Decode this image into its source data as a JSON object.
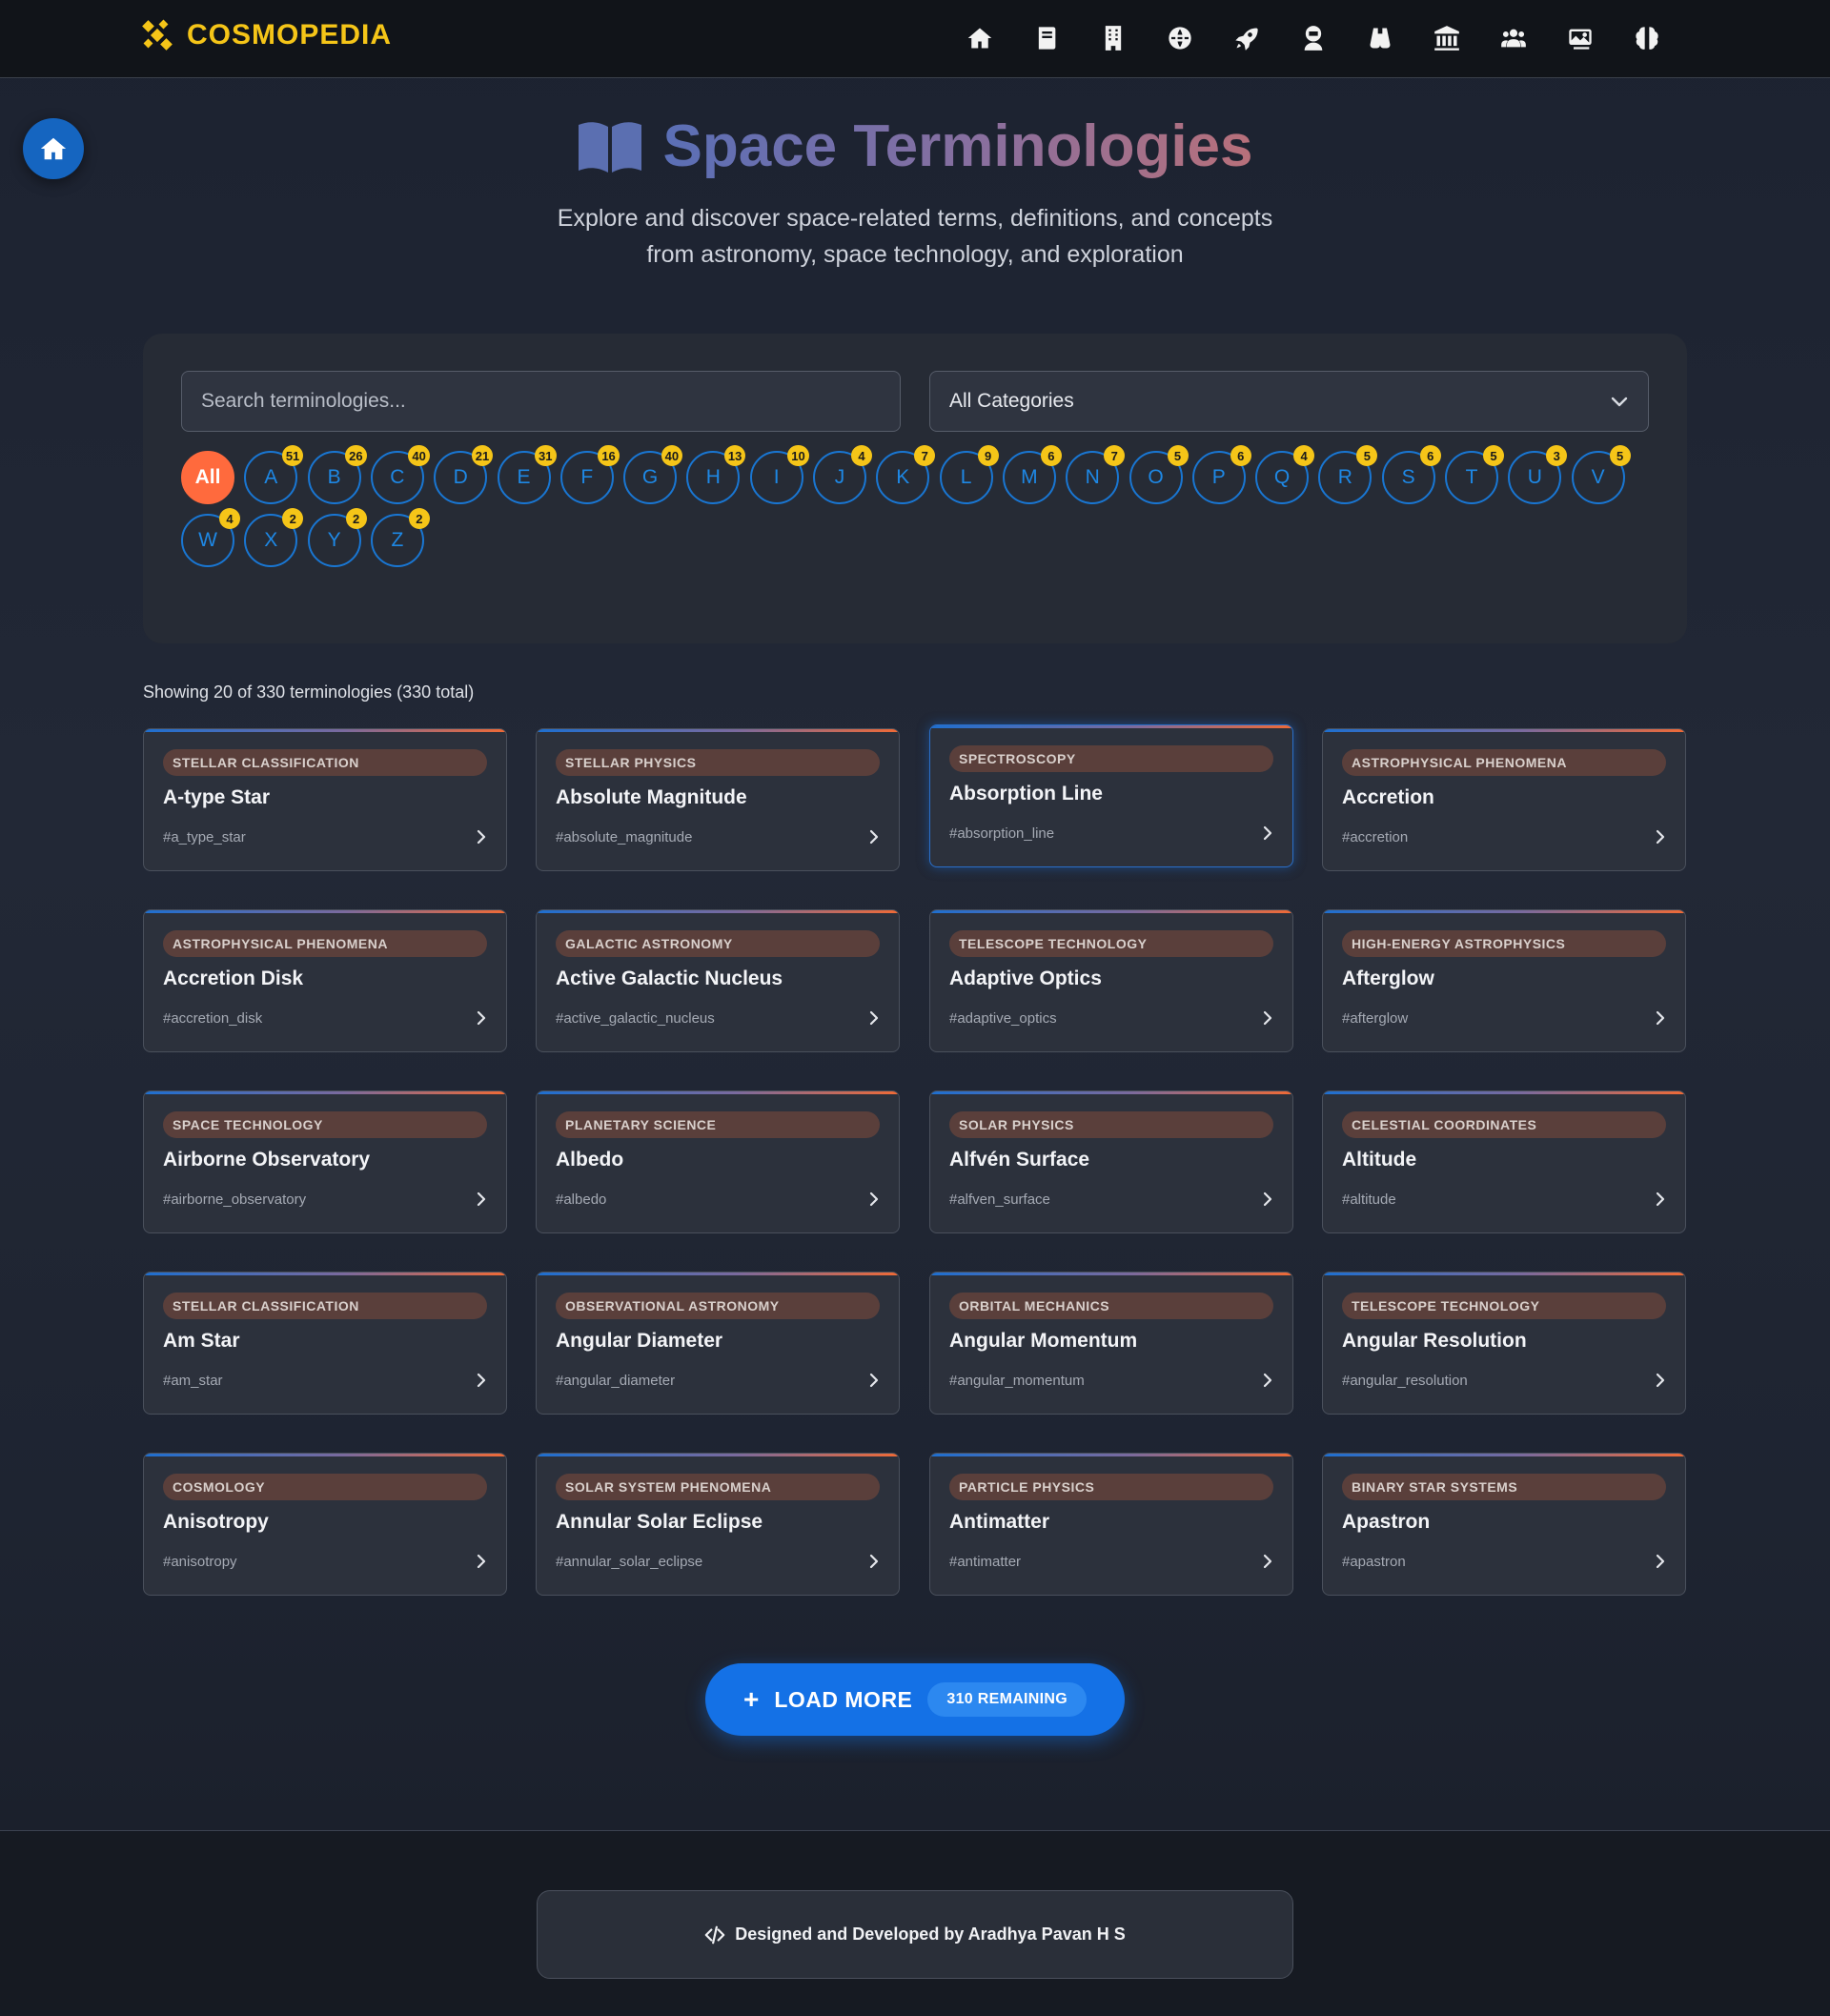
{
  "brand": {
    "name": "COSMOPEDIA",
    "color": "#f5c518"
  },
  "nav": {
    "icons": [
      "home-icon",
      "book-icon",
      "building-icon",
      "globe-icon",
      "rocket-icon",
      "astronaut-icon",
      "binoculars-icon",
      "museum-icon",
      "people-icon",
      "gallery-icon",
      "brain-icon"
    ]
  },
  "hero": {
    "title": "Space Terminologies",
    "subtitle": "Explore and discover space-related terms, definitions, and concepts from astronomy, space technology, and exploration"
  },
  "filters": {
    "search_placeholder": "Search terminologies...",
    "category_selected": "All Categories",
    "letters": [
      {
        "label": "All",
        "count": null
      },
      {
        "label": "A",
        "count": "51"
      },
      {
        "label": "B",
        "count": "26"
      },
      {
        "label": "C",
        "count": "40"
      },
      {
        "label": "D",
        "count": "21"
      },
      {
        "label": "E",
        "count": "31"
      },
      {
        "label": "F",
        "count": "16"
      },
      {
        "label": "G",
        "count": "40"
      },
      {
        "label": "H",
        "count": "13"
      },
      {
        "label": "I",
        "count": "10"
      },
      {
        "label": "J",
        "count": "4"
      },
      {
        "label": "K",
        "count": "7"
      },
      {
        "label": "L",
        "count": "9"
      },
      {
        "label": "M",
        "count": "6"
      },
      {
        "label": "N",
        "count": "7"
      },
      {
        "label": "O",
        "count": "5"
      },
      {
        "label": "P",
        "count": "6"
      },
      {
        "label": "Q",
        "count": "4"
      },
      {
        "label": "R",
        "count": "5"
      },
      {
        "label": "S",
        "count": "6"
      },
      {
        "label": "T",
        "count": "5"
      },
      {
        "label": "U",
        "count": "3"
      },
      {
        "label": "V",
        "count": "5"
      },
      {
        "label": "W",
        "count": "4"
      },
      {
        "label": "X",
        "count": "2"
      },
      {
        "label": "Y",
        "count": "2"
      },
      {
        "label": "Z",
        "count": "2"
      }
    ]
  },
  "results": {
    "showing": "Showing 20 of 330 terminologies (330 total)",
    "cards": [
      {
        "category": "Stellar Classification",
        "title": "A-type Star",
        "tag": "#a_type_star"
      },
      {
        "category": "Stellar Physics",
        "title": "Absolute Magnitude",
        "tag": "#absolute_magnitude"
      },
      {
        "category": "Spectroscopy",
        "title": "Absorption Line",
        "tag": "#absorption_line"
      },
      {
        "category": "Astrophysical Phenomena",
        "title": "Accretion",
        "tag": "#accretion"
      },
      {
        "category": "Astrophysical Phenomena",
        "title": "Accretion Disk",
        "tag": "#accretion_disk"
      },
      {
        "category": "Galactic Astronomy",
        "title": "Active Galactic Nucleus",
        "tag": "#active_galactic_nucleus"
      },
      {
        "category": "Telescope Technology",
        "title": "Adaptive Optics",
        "tag": "#adaptive_optics"
      },
      {
        "category": "High-Energy Astrophysics",
        "title": "Afterglow",
        "tag": "#afterglow"
      },
      {
        "category": "Space Technology",
        "title": "Airborne Observatory",
        "tag": "#airborne_observatory"
      },
      {
        "category": "Planetary Science",
        "title": "Albedo",
        "tag": "#albedo"
      },
      {
        "category": "Solar Physics",
        "title": "Alfvén Surface",
        "tag": "#alfven_surface"
      },
      {
        "category": "Celestial Coordinates",
        "title": "Altitude",
        "tag": "#altitude"
      },
      {
        "category": "Stellar Classification",
        "title": "Am Star",
        "tag": "#am_star"
      },
      {
        "category": "Observational Astronomy",
        "title": "Angular Diameter",
        "tag": "#angular_diameter"
      },
      {
        "category": "Orbital Mechanics",
        "title": "Angular Momentum",
        "tag": "#angular_momentum"
      },
      {
        "category": "Telescope Technology",
        "title": "Angular Resolution",
        "tag": "#angular_resolution"
      },
      {
        "category": "Cosmology",
        "title": "Anisotropy",
        "tag": "#anisotropy"
      },
      {
        "category": "Solar System Phenomena",
        "title": "Annular Solar Eclipse",
        "tag": "#annular_solar_eclipse"
      },
      {
        "category": "Particle Physics",
        "title": "Antimatter",
        "tag": "#antimatter"
      },
      {
        "category": "Binary Star Systems",
        "title": "Apastron",
        "tag": "#apastron"
      }
    ]
  },
  "load_more": {
    "label": "LOAD MORE",
    "remaining": "310 REMAINING"
  },
  "footer": {
    "credit": "Designed and Developed by Aradhya Pavan H S"
  }
}
